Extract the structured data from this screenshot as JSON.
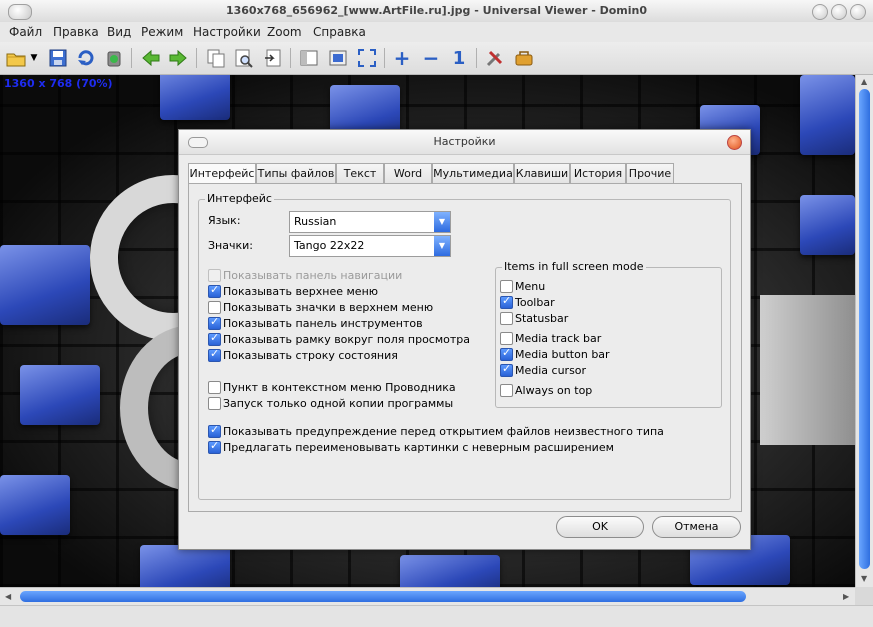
{
  "window": {
    "title": "1360x768_656962_[www.ArtFile.ru].jpg - Universal Viewer - Domin0"
  },
  "menu": [
    "Файл",
    "Правка",
    "Вид",
    "Режим",
    "Настройки",
    "Zoom",
    "Справка"
  ],
  "toolbar_icons": [
    "open-icon",
    "dropdown-arrow-icon",
    "save-icon",
    "rotate-icon",
    "recycle-icon",
    "back-arrow-icon",
    "forward-arrow-icon",
    "copy-icon",
    "find-icon",
    "export-icon",
    "panel-icon",
    "image-icon",
    "fullscreen-icon",
    "zoom-in-icon",
    "zoom-out-icon",
    "zoom-original-icon",
    "tools-icon",
    "plugins-icon"
  ],
  "toolbar_glyphs": {
    "zoom_in": "+",
    "zoom_out": "−",
    "zoom_original": "1"
  },
  "image_info": "1360 x 768 (70%)",
  "dialog": {
    "title": "Настройки",
    "tabs": [
      "Интерфейс",
      "Типы файлов",
      "Текст",
      "Word",
      "Мультимедиа",
      "Клавиши",
      "История",
      "Прочие"
    ],
    "active_tab": "Интерфейс",
    "group_label": "Интерфейс",
    "language_label": "Язык:",
    "language_value": "Russian",
    "icons_label": "Значки:",
    "icons_value": "Tango 22x22",
    "options": [
      {
        "label": "Показывать панель навигации",
        "checked": false,
        "disabled": true
      },
      {
        "label": "Показывать верхнее меню",
        "checked": true
      },
      {
        "label": "Показывать значки в верхнем меню",
        "checked": false
      },
      {
        "label": "Показывать панель инструментов",
        "checked": true
      },
      {
        "label": "Показывать рамку вокруг поля просмотра",
        "checked": true
      },
      {
        "label": "Показывать строку состояния",
        "checked": true
      }
    ],
    "shell_options": [
      {
        "label": "Пункт в контекстном меню Проводника",
        "checked": false
      },
      {
        "label": "Запуск только одной копии программы",
        "checked": false
      }
    ],
    "warn_options": [
      {
        "label": "Показывать предупреждение перед открытием файлов неизвестного типа",
        "checked": true
      },
      {
        "label": "Предлагать переименовывать картинки с неверным расширением",
        "checked": true
      }
    ],
    "fullscreen_group": "Items in full screen mode",
    "fullscreen_items": [
      {
        "label": "Menu",
        "checked": false
      },
      {
        "label": "Toolbar",
        "checked": true
      },
      {
        "label": "Statusbar",
        "checked": false
      },
      {
        "label": "Media track bar",
        "checked": false
      },
      {
        "label": "Media button bar",
        "checked": true
      },
      {
        "label": "Media cursor",
        "checked": true
      },
      {
        "label": "Always on top",
        "checked": false
      }
    ],
    "ok_label": "OK",
    "cancel_label": "Отмена"
  },
  "colors": {
    "accent": "#2e6be0",
    "image_info": "#1e2cf0"
  }
}
